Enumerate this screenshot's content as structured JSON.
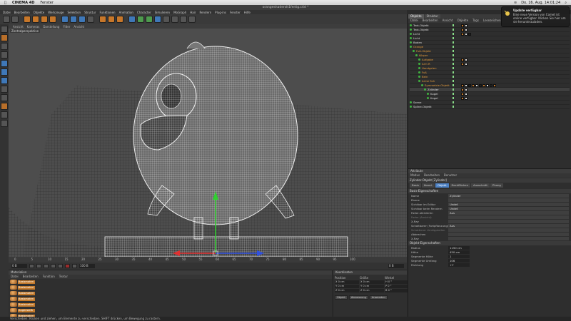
{
  "macos": {
    "apple": "",
    "app_name": "CINEMA 4D",
    "menu": [
      "Fenster"
    ],
    "clock": "Do. 16. Aug. 14:01:24"
  },
  "window": {
    "title": "orangeshaderslt1fertig.c4d *"
  },
  "main_menu": [
    "Datei",
    "Bearbeiten",
    "Objekte",
    "Werkzeuge",
    "Selektion",
    "Struktur",
    "Funktionen",
    "Animation",
    "Character",
    "Simulieren",
    "MoGraph",
    "Hair",
    "Rendern",
    "Plug-ins",
    "Fenster",
    "Hilfe"
  ],
  "viewport": {
    "menu": [
      "Ansicht",
      "Kameras",
      "Darstellung",
      "Filter",
      "Ansicht"
    ],
    "label": "Zentralperspektive"
  },
  "timeline": {
    "ticks": [
      "0",
      "5",
      "10",
      "15",
      "20",
      "25",
      "30",
      "35",
      "40",
      "45",
      "50",
      "55",
      "60",
      "65",
      "70",
      "75",
      "80",
      "85",
      "90",
      "95",
      "100"
    ],
    "frame_start": "0 B",
    "frame_end": "100 B",
    "current_frame": "0 B"
  },
  "materials": {
    "title": "Materialien",
    "menu": [
      "Datei",
      "Bearbeiten",
      "Funktion",
      "Textur"
    ],
    "items": [
      "Basismateri",
      "Basismateri",
      "Basismateri",
      "Basismateri",
      "Basismateri",
      "Augenweiß",
      "Basismateri",
      "Basismateri"
    ]
  },
  "coordinates": {
    "title": "Koordinaten",
    "headers": [
      "Position",
      "Größe",
      "Winkel"
    ],
    "rows": [
      [
        "X 0 cm",
        "X 0 cm",
        "H 0 °"
      ],
      [
        "Y 0 cm",
        "Y 0 cm",
        "P 0 °"
      ],
      [
        "Z 0 cm",
        "Z 0 cm",
        "B 0 °"
      ]
    ],
    "mode_left": "Objekt",
    "mode_mid": "Abmessung",
    "apply": "Anwenden"
  },
  "objects": {
    "tabs": [
      "Objekte",
      "Struktur"
    ],
    "menu": [
      "Datei",
      "Bearbeiten",
      "Ansicht",
      "Objekte",
      "Tags",
      "Lesezeichen"
    ],
    "rows": [
      {
        "name": "Text-Objekt",
        "indent": 0,
        "orange": false
      },
      {
        "name": "Text-Objekt",
        "indent": 0,
        "orange": false
      },
      {
        "name": "Licht",
        "indent": 0,
        "orange": false
      },
      {
        "name": "Licht",
        "indent": 0,
        "orange": false
      },
      {
        "name": "Boden",
        "indent": 0,
        "orange": false
      },
      {
        "name": "Orange",
        "indent": 0,
        "orange": true
      },
      {
        "name": "Fuß-Objekt",
        "indent": 1,
        "orange": true
      },
      {
        "name": "Körper",
        "indent": 2,
        "orange": true
      },
      {
        "name": "Aufgabe",
        "indent": 3,
        "orange": true
      },
      {
        "name": "Arm R",
        "indent": 3,
        "orange": true
      },
      {
        "name": "Handgelen",
        "indent": 3,
        "orange": true
      },
      {
        "name": "Fuß",
        "indent": 3,
        "orange": true
      },
      {
        "name": "Bein",
        "indent": 3,
        "orange": true
      },
      {
        "name": "Arme Sch",
        "indent": 3,
        "orange": true
      },
      {
        "name": "Symmetrie-Objekt",
        "indent": 4,
        "orange": true
      },
      {
        "name": "Zylinder",
        "indent": 5,
        "orange": false
      },
      {
        "name": "Kugel",
        "indent": 6,
        "orange": false
      },
      {
        "name": "Kugel",
        "indent": 6,
        "orange": false
      },
      {
        "name": "Szene",
        "indent": 0,
        "orange": false
      },
      {
        "name": "Spline-Objekt",
        "indent": 0,
        "orange": false
      }
    ]
  },
  "notification": {
    "title": "Update verfügbar",
    "body": "Eine neue Version von Comet ist online verfügbar. Klicken Sie hier um sie herunterzuladen."
  },
  "attributes": {
    "title": "Attribute",
    "menu": [
      "Modus",
      "Bearbeiten",
      "Benutzer"
    ],
    "object_title": "Zylinder-Objekt [Zylinder]",
    "tabs": [
      "Basis",
      "Koord.",
      "Objekt",
      "Deckflächen",
      "Ausschnitt",
      "Phong"
    ],
    "active_tab": 2,
    "basis_section": "Basis-Eigenschaften",
    "basis_rows": [
      {
        "label": "Name",
        "value": "Zylinder",
        "dim": false
      },
      {
        "label": "Ebene",
        "value": "",
        "dim": false
      },
      {
        "label": "Sichtbar im Editor",
        "value": "Undef.",
        "dim": false
      },
      {
        "label": "Sichtbar beim Rendern",
        "value": "Undef.",
        "dim": false
      },
      {
        "label": "Farbe aktivieren",
        "value": "Aus",
        "dim": false
      },
      {
        "label": "Farbe (Ansicht)",
        "value": "",
        "dim": true
      },
      {
        "label": "X-Ray",
        "value": "",
        "dim": false
      },
      {
        "label": "Schaltbarer (Fortpflanzung)",
        "value": "Aus",
        "dim": false
      },
      {
        "label": "Schattierer Umkippteilen",
        "value": "",
        "dim": true
      },
      {
        "label": "Abbrechen",
        "value": "",
        "dim": false
      },
      {
        "label": "X-Ray",
        "value": "",
        "dim": false
      }
    ],
    "object_section": "Objekt-Eigenschaften",
    "object_rows": [
      {
        "label": "Radius",
        "value": "1150 cm"
      },
      {
        "label": "Höhe",
        "value": "450 cm"
      },
      {
        "label": "Segmente Höhe",
        "value": "1"
      },
      {
        "label": "Segmente Umfang",
        "value": "106"
      },
      {
        "label": "Richtung",
        "value": "+Y"
      }
    ]
  },
  "status": {
    "text": "Verschieben: Klicken und ziehen, um Elemente zu verschieben. SHIFT drücken, um Bewegung zu rastern."
  }
}
